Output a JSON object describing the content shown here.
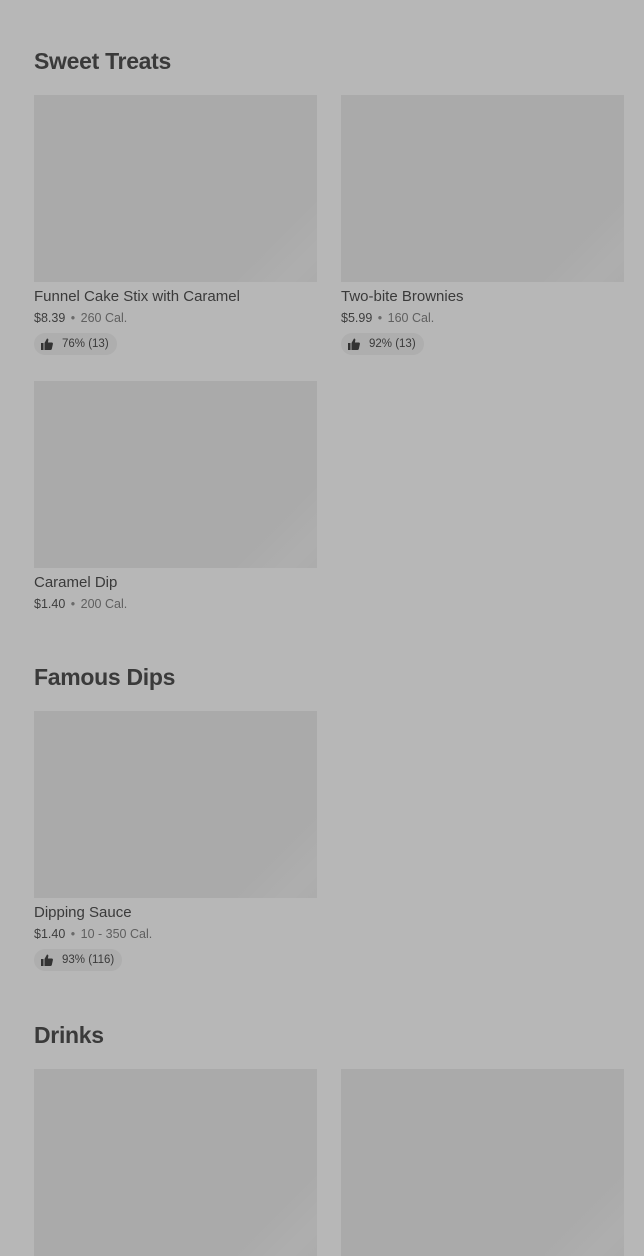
{
  "sections": [
    {
      "title": "Sweet Treats",
      "items": [
        {
          "name": "Funnel Cake Stix with Caramel",
          "price": "$8.39",
          "calories": "260 Cal.",
          "rating": "76% (13)"
        },
        {
          "name": "Two-bite Brownies",
          "price": "$5.99",
          "calories": "160 Cal.",
          "rating": "92% (13)"
        },
        {
          "name": "Caramel Dip",
          "price": "$1.40",
          "calories": "200 Cal."
        }
      ]
    },
    {
      "title": "Famous Dips",
      "items": [
        {
          "name": "Dipping Sauce",
          "price": "$1.40",
          "calories": "10 - 350 Cal.",
          "rating": "93% (116)"
        }
      ]
    },
    {
      "title": "Drinks",
      "items": []
    }
  ],
  "icons": {
    "rating": "thumbs-up-icon"
  },
  "separator": "•"
}
